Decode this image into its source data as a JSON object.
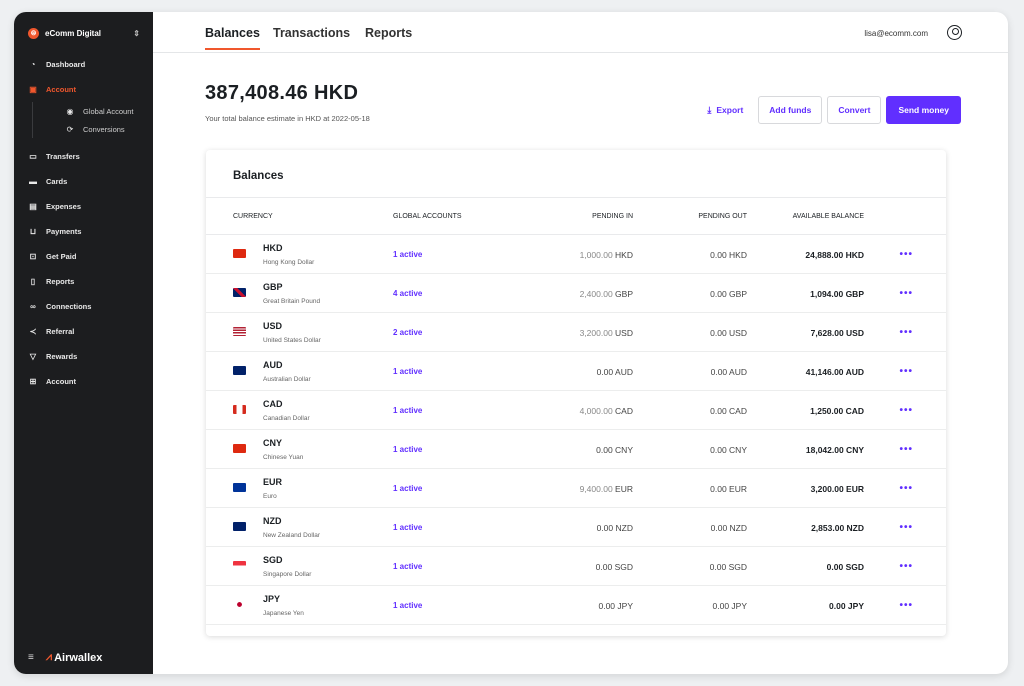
{
  "org": {
    "name": "eComm Digital"
  },
  "nav": {
    "items": [
      {
        "label": "Dashboard"
      },
      {
        "label": "Account"
      },
      {
        "label": "Transfers"
      },
      {
        "label": "Cards"
      },
      {
        "label": "Expenses"
      },
      {
        "label": "Payments"
      },
      {
        "label": "Get Paid"
      },
      {
        "label": "Reports"
      },
      {
        "label": "Connections"
      },
      {
        "label": "Referral"
      },
      {
        "label": "Rewards"
      },
      {
        "label": "Account"
      }
    ],
    "sub_items": [
      {
        "label": "Global Account"
      },
      {
        "label": "Conversions"
      }
    ]
  },
  "brand": {
    "name": "Airwallex"
  },
  "tabs": [
    {
      "label": "Balances"
    },
    {
      "label": "Transactions"
    },
    {
      "label": "Reports"
    }
  ],
  "user": {
    "email": "lisa@ecomm.com"
  },
  "summary": {
    "total": "387,408.46 HKD",
    "subtitle": "Your total balance estimate in HKD at 2022-05-18"
  },
  "actions": {
    "export": "Export",
    "add_funds": "Add funds",
    "convert": "Convert",
    "send_money": "Send money"
  },
  "table": {
    "title": "Balances",
    "headers": [
      "CURRENCY",
      "GLOBAL ACCOUNTS",
      "PENDING IN",
      "PENDING OUT",
      "AVAILABLE BALANCE"
    ],
    "rows": [
      {
        "code": "HKD",
        "name": "Hong Kong Dollar",
        "accounts": "1 active",
        "pending_in_num": "1,000.00",
        "pending_in_cur": "HKD",
        "pending_out": "0.00 HKD",
        "available": "24,888.00 HKD"
      },
      {
        "code": "GBP",
        "name": "Great Britain Pound",
        "accounts": "4 active",
        "pending_in_num": "2,400.00",
        "pending_in_cur": "GBP",
        "pending_out": "0.00 GBP",
        "available": "1,094.00 GBP"
      },
      {
        "code": "USD",
        "name": "United States Dollar",
        "accounts": "2 active",
        "pending_in_num": "3,200.00",
        "pending_in_cur": "USD",
        "pending_out": "0.00 USD",
        "available": "7,628.00 USD"
      },
      {
        "code": "AUD",
        "name": "Australian Dollar",
        "accounts": "1 active",
        "pending_in_num": "0.00",
        "pending_in_cur": "AUD",
        "pending_out": "0.00 AUD",
        "available": "41,146.00 AUD"
      },
      {
        "code": "CAD",
        "name": "Canadian Dollar",
        "accounts": "1 active",
        "pending_in_num": "4,000.00",
        "pending_in_cur": "CAD",
        "pending_out": "0.00 CAD",
        "available": "1,250.00 CAD"
      },
      {
        "code": "CNY",
        "name": "Chinese Yuan",
        "accounts": "1 active",
        "pending_in_num": "0.00",
        "pending_in_cur": "CNY",
        "pending_out": "0.00 CNY",
        "available": "18,042.00 CNY"
      },
      {
        "code": "EUR",
        "name": "Euro",
        "accounts": "1 active",
        "pending_in_num": "9,400.00",
        "pending_in_cur": "EUR",
        "pending_out": "0.00 EUR",
        "available": "3,200.00 EUR"
      },
      {
        "code": "NZD",
        "name": "New Zealand Dollar",
        "accounts": "1 active",
        "pending_in_num": "0.00",
        "pending_in_cur": "NZD",
        "pending_out": "0.00 NZD",
        "available": "2,853.00 NZD"
      },
      {
        "code": "SGD",
        "name": "Singapore Dollar",
        "accounts": "1 active",
        "pending_in_num": "0.00",
        "pending_in_cur": "SGD",
        "pending_out": "0.00 SGD",
        "available": "0.00 SGD"
      },
      {
        "code": "JPY",
        "name": "Japanese Yen",
        "accounts": "1 active",
        "pending_in_num": "0.00",
        "pending_in_cur": "JPY",
        "pending_out": "0.00 JPY",
        "available": "0.00 JPY"
      }
    ]
  },
  "colors": {
    "accent": "#612fff",
    "brand": "#f0572d",
    "sidebar": "#1c1d1f"
  },
  "icons": [
    "dashboard-icon",
    "wallet-icon",
    "transfer-icon",
    "card-icon",
    "expense-icon",
    "cart-icon",
    "get-paid-icon",
    "report-icon",
    "link-icon",
    "share-icon",
    "trophy-icon",
    "store-icon",
    "export-icon",
    "user-icon",
    "more-icon"
  ]
}
